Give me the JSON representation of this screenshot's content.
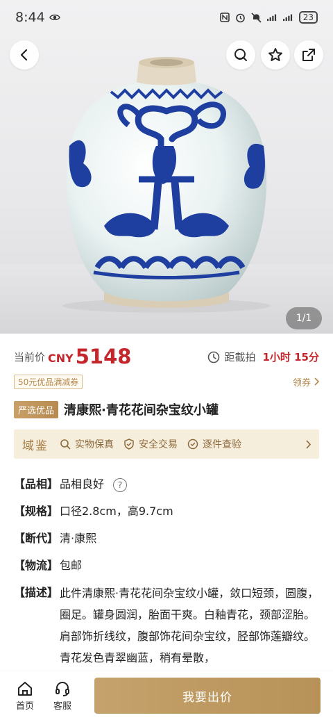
{
  "status_bar": {
    "time": "8:44",
    "battery": "23",
    "icons": [
      "eye-icon",
      "nfc-icon",
      "alarm-icon",
      "mute-icon",
      "signal-icon",
      "wifi-icon",
      "battery-icon"
    ]
  },
  "hero": {
    "image_counter": "1/1",
    "icons": {
      "back": "chevron-left-icon",
      "service": "customer-service-icon",
      "favorite": "star-icon",
      "share": "share-icon"
    }
  },
  "price": {
    "label": "当前价",
    "currency": "CNY",
    "value": "5148",
    "deadline_label": "距截拍",
    "deadline_value": "1小时 15分"
  },
  "coupon": {
    "badge": "50元优品满减券",
    "link": "领券"
  },
  "item": {
    "tag": "严选优品",
    "title": "清康熙·青花花间杂宝纹小罐"
  },
  "guarantee": {
    "brand": "域鉴",
    "items": [
      "实物保真",
      "安全交易",
      "逐件查验"
    ]
  },
  "details": {
    "rows": [
      {
        "key": "【品相】",
        "value": "品相良好"
      },
      {
        "key": "【规格】",
        "value": "口径2.8cm，高9.7cm"
      },
      {
        "key": "【断代】",
        "value": "清·康熙"
      },
      {
        "key": "【物流】",
        "value": "包邮"
      },
      {
        "key": "【描述】",
        "value": "此件清康熙·青花花间杂宝纹小罐，敛口短颈，圆腹，圈足。罐身圆润，胎面干爽。白釉青花，颈部涩胎。肩部饰折线纹，腹部饰花间杂宝纹，胫部饰莲瓣纹。青花发色青翠幽蓝，稍有晕散，"
      }
    ],
    "help_mark": "?"
  },
  "bottom": {
    "home_label": "首页",
    "service_label": "客服",
    "cta_label": "我要出价"
  },
  "colors": {
    "accent_red": "#c4262b",
    "gold": "#b79258",
    "guarantee_bg": "#f6eedd",
    "cobalt": "#1e3fa0"
  }
}
